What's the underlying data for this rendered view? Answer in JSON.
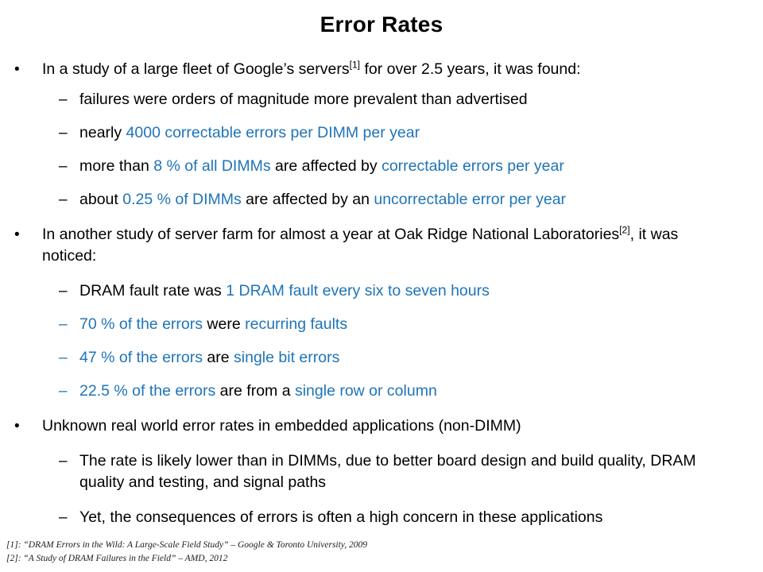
{
  "slide": {
    "title": "Error Rates",
    "accent_color": "#1f74b8",
    "text_color": "#000000",
    "background_color": "#ffffff",
    "markers": {
      "level1": "•",
      "level2": "–"
    }
  },
  "content": {
    "b1": {
      "marker": "•",
      "pre": "In a study of a large fleet of Google’s servers",
      "ref": "[1]",
      "post": " for over 2.5 years, it was found:"
    },
    "b1s1": {
      "marker": "–",
      "text": "failures were orders of magnitude more prevalent than advertised"
    },
    "b1s2": {
      "marker": "–",
      "black1": "nearly ",
      "blue1": "4000 correctable errors per DIMM per year"
    },
    "b1s3": {
      "marker": "–",
      "black1": "more than ",
      "blue1": "8 % of all DIMMs",
      "black2": " are affected by ",
      "blue2": "correctable errors per year"
    },
    "b1s4": {
      "marker": "–",
      "black1": "about ",
      "blue1": "0.25 % of DIMMs",
      "black2": " are affected by an ",
      "blue2": "uncorrectable error per year"
    },
    "b2": {
      "marker": "•",
      "pre": "In another study of server farm for almost a year at Oak Ridge National Laboratories",
      "ref": "[2]",
      "post": ", it was noticed:"
    },
    "b2s1": {
      "marker": "–",
      "black1": "DRAM fault rate was ",
      "blue1": "1 DRAM fault every six to seven hours"
    },
    "b2s2": {
      "marker": "–",
      "blue1": "70 % of the errors",
      "black1": " were ",
      "blue2": "recurring faults"
    },
    "b2s3": {
      "marker": "–",
      "blue1": "47 % of the errors",
      "black1": " are ",
      "blue2": "single bit errors"
    },
    "b2s4": {
      "marker": "–",
      "blue1": "22.5 % of the errors",
      "black1": " are from a ",
      "blue2": "single row or column"
    },
    "b3": {
      "marker": "•",
      "text": "Unknown real world error rates in embedded applications (non-DIMM)"
    },
    "b3s1": {
      "marker": "–",
      "text": "The rate is likely lower than in DIMMs, due to better board design and build quality, DRAM quality and testing, and signal paths"
    },
    "b3s2": {
      "marker": "–",
      "text": "Yet, the consequences of errors is often a high concern in these applications"
    }
  },
  "footnotes": [
    "[1]: “DRAM Errors in the Wild: A Large-Scale Field Study” – Google & Toronto University,  2009",
    "[2]: “A Study of DRAM Failures in the Field” – AMD, 2012"
  ]
}
